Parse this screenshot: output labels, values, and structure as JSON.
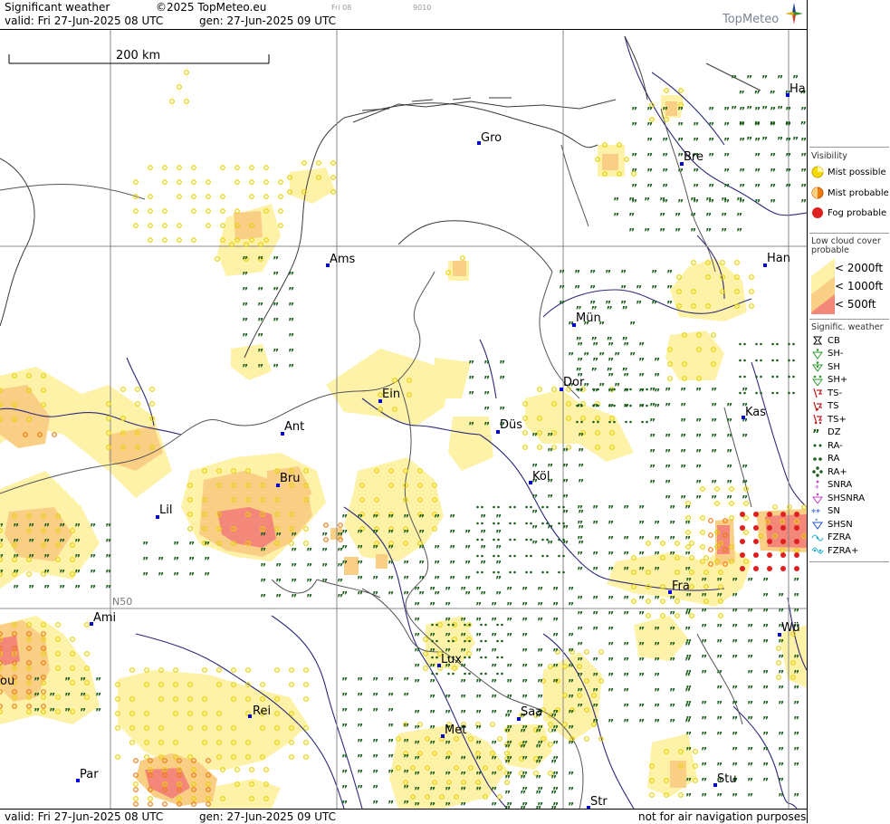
{
  "header": {
    "product": "Significant weather",
    "copyright": "©2025 TopMeteo.eu",
    "valid": "valid:  Fri  27-Jun-2025  08 UTC",
    "gen": "gen: 27-Jun-2025 09 UTC",
    "faint_day": "Fri 08",
    "faint_code": "9010",
    "logo_text": "TopMeteo"
  },
  "scale": {
    "label": "200 km"
  },
  "grid_label": "N50",
  "footer": {
    "valid": "valid:  Fri  27-Jun-2025  08 UTC",
    "gen": "gen: 27-Jun-2025 09 UTC",
    "disclaimer": "not for air navigation purposes"
  },
  "legend": {
    "visibility_title": "Visibility",
    "visibility": [
      "Mist possible",
      "Mist probable",
      "Fog probable"
    ],
    "cloud_title_1": "Low cloud cover",
    "cloud_title_2": "probable",
    "cloud": [
      "< 2000ft",
      "< 1000ft",
      "<   500ft"
    ],
    "weather_title": "Signific. weather",
    "weather": [
      "CB",
      "SH-",
      "SH",
      "SH+",
      "TS-",
      "TS",
      "TS+",
      "DZ",
      "RA-",
      "RA",
      "RA+",
      "SNRA",
      "SHSNRA",
      "SN",
      "SHSN",
      "FZRA",
      "FZRA+"
    ]
  },
  "cities": [
    {
      "name": "Gro"
    },
    {
      "name": "Bre"
    },
    {
      "name": "Ha"
    },
    {
      "name": "Ams"
    },
    {
      "name": "Han"
    },
    {
      "name": "Mün"
    },
    {
      "name": "Ein"
    },
    {
      "name": "Dor"
    },
    {
      "name": "Kas"
    },
    {
      "name": "Ant"
    },
    {
      "name": "Düs"
    },
    {
      "name": "Bru"
    },
    {
      "name": "Köl"
    },
    {
      "name": "Lil"
    },
    {
      "name": "Fra"
    },
    {
      "name": "Ami"
    },
    {
      "name": "Wü"
    },
    {
      "name": "Lux"
    },
    {
      "name": "Saa"
    },
    {
      "name": "Rei"
    },
    {
      "name": "Met"
    },
    {
      "name": "ou"
    },
    {
      "name": "Par"
    },
    {
      "name": "Stu"
    },
    {
      "name": "Str"
    }
  ],
  "colors": {
    "cloud_2000": "#fdf2a8",
    "cloud_1000": "#f9cf86",
    "cloud_500": "#f3877a",
    "mist_possible": "#e8d000",
    "mist_probable": "#f07a10",
    "fog_probable": "#e02020",
    "drizzle": "#1a5c1a",
    "city": "#0000dd"
  }
}
